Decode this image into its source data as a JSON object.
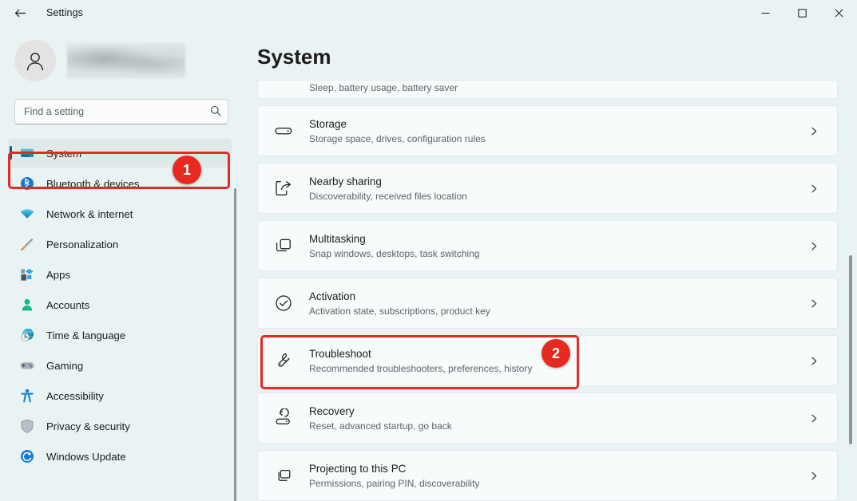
{
  "window": {
    "title": "Settings",
    "back_icon": "back-arrow-icon",
    "controls": {
      "minimize": "minimize-icon",
      "maximize": "maximize-icon",
      "close": "close-icon"
    }
  },
  "sidebar": {
    "account": {
      "avatar_icon": "person-avatar-icon",
      "name_redacted": true
    },
    "search": {
      "placeholder": "Find a setting",
      "value": "",
      "icon": "search-icon"
    },
    "items": [
      {
        "label": "System",
        "icon": "monitor-icon",
        "selected": true
      },
      {
        "label": "Bluetooth & devices",
        "icon": "bluetooth-icon",
        "selected": false
      },
      {
        "label": "Network & internet",
        "icon": "wifi-icon",
        "selected": false
      },
      {
        "label": "Personalization",
        "icon": "paintbrush-icon",
        "selected": false
      },
      {
        "label": "Apps",
        "icon": "apps-grid-icon",
        "selected": false
      },
      {
        "label": "Accounts",
        "icon": "person-icon",
        "selected": false
      },
      {
        "label": "Time & language",
        "icon": "clock-globe-icon",
        "selected": false
      },
      {
        "label": "Gaming",
        "icon": "gamepad-icon",
        "selected": false
      },
      {
        "label": "Accessibility",
        "icon": "accessibility-icon",
        "selected": false
      },
      {
        "label": "Privacy & security",
        "icon": "shield-icon",
        "selected": false
      },
      {
        "label": "Windows Update",
        "icon": "update-refresh-icon",
        "selected": false
      }
    ]
  },
  "main": {
    "title": "System",
    "rows": [
      {
        "title": "",
        "subtitle": "Sleep, battery usage, battery saver",
        "icon": "battery-icon",
        "clipped": true
      },
      {
        "title": "Storage",
        "subtitle": "Storage space, drives, configuration rules",
        "icon": "storage-drive-icon",
        "clipped": false
      },
      {
        "title": "Nearby sharing",
        "subtitle": "Discoverability, received files location",
        "icon": "share-icon",
        "clipped": false
      },
      {
        "title": "Multitasking",
        "subtitle": "Snap windows, desktops, task switching",
        "icon": "multitasking-windows-icon",
        "clipped": false
      },
      {
        "title": "Activation",
        "subtitle": "Activation state, subscriptions, product key",
        "icon": "check-circle-icon",
        "clipped": false
      },
      {
        "title": "Troubleshoot",
        "subtitle": "Recommended troubleshooters, preferences, history",
        "icon": "wrench-icon",
        "clipped": false
      },
      {
        "title": "Recovery",
        "subtitle": "Reset, advanced startup, go back",
        "icon": "recovery-icon",
        "clipped": false
      },
      {
        "title": "Projecting to this PC",
        "subtitle": "Permissions, pairing PIN, discoverability",
        "icon": "project-screen-icon",
        "clipped": false
      }
    ],
    "chevron_icon": "chevron-right-icon"
  },
  "annotations": {
    "color": "#e8291f",
    "markers": [
      {
        "number": "1",
        "target": "sidebar-item-system"
      },
      {
        "number": "2",
        "target": "settings-row-troubleshoot"
      }
    ]
  },
  "scrollbars": {
    "sidebar": "sidebar-scrollbar",
    "main": "main-scrollbar"
  }
}
